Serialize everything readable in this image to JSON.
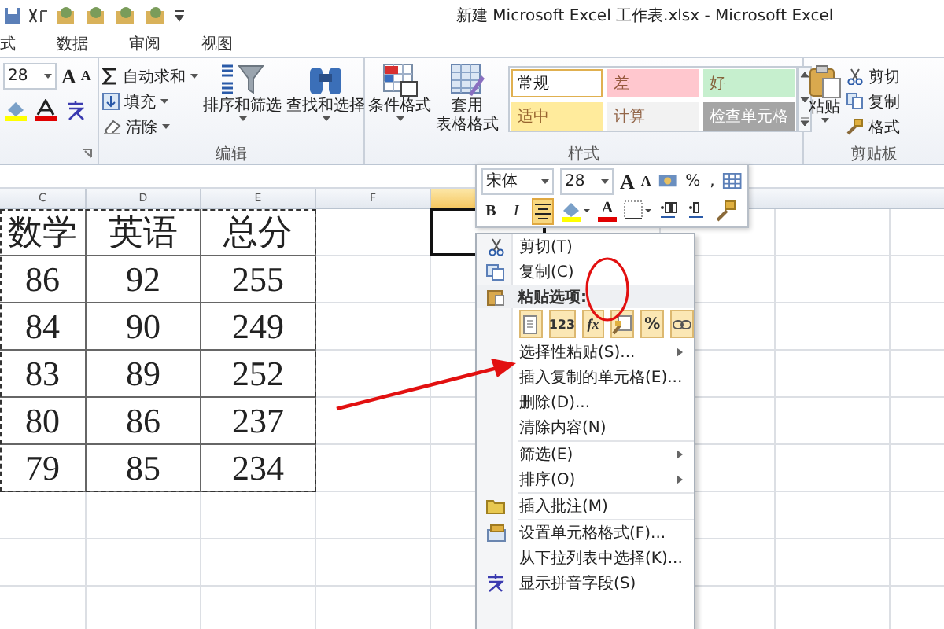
{
  "title_bar": {
    "title": "新建 Microsoft Excel 工作表.xlsx - Microsoft Excel"
  },
  "tabs": [
    {
      "label": "式",
      "selected": false
    },
    {
      "label": "数据",
      "selected": false
    },
    {
      "label": "审阅",
      "selected": false
    },
    {
      "label": "视图",
      "selected": false
    }
  ],
  "ribbon": {
    "font_group": {
      "font_size": "28",
      "grow": "A",
      "shrink": "A"
    },
    "editing_group": {
      "label": "编辑",
      "small_buttons": [
        "自动求和",
        "填充",
        "清除"
      ],
      "large_buttons": [
        {
          "lines": [
            "排序和筛选"
          ]
        },
        {
          "lines": [
            "查找和选择"
          ]
        }
      ]
    },
    "styles_group": {
      "label": "样式",
      "large_buttons": [
        {
          "lines": [
            "条件格式"
          ]
        },
        {
          "lines": [
            "套用",
            "表格格式"
          ]
        }
      ],
      "cell_styles": [
        {
          "label": "常规",
          "color": "#ffffff",
          "selected": true
        },
        {
          "label": "差",
          "color": "#ffc7ce",
          "selected": false
        },
        {
          "label": "好",
          "color": "#c6efce",
          "selected": false
        },
        {
          "label": "适中",
          "color": "#ffeb9c",
          "selected": false
        },
        {
          "label": "计算",
          "color": "#f2f2f2",
          "selected": false
        },
        {
          "label": "检查单元格",
          "color": "#a5a5a5",
          "selected": false
        }
      ]
    },
    "clipboard_group": {
      "label": "剪贴板",
      "paste": "粘贴",
      "small_buttons": [
        "剪切",
        "复制",
        "格式"
      ]
    }
  },
  "sheet": {
    "columns": [
      {
        "label": "C",
        "selected": false
      },
      {
        "label": "D",
        "selected": false
      },
      {
        "label": "E",
        "selected": false
      },
      {
        "label": "F",
        "selected": false
      },
      {
        "selected": true
      }
    ],
    "rows": [
      [
        "数学",
        "英语",
        "总分"
      ],
      [
        "86",
        "92",
        "255"
      ],
      [
        "84",
        "90",
        "249"
      ],
      [
        "83",
        "89",
        "252"
      ],
      [
        "80",
        "86",
        "237"
      ],
      [
        "79",
        "85",
        "234"
      ]
    ],
    "copy_marquee": true
  },
  "mini_toolbar": {
    "font": "宋体",
    "size": "28",
    "grow": "A",
    "shrink": "A",
    "percent": "%",
    "comma": ",",
    "buttons": [
      {
        "kind": "bold",
        "label": "B",
        "selected": false
      },
      {
        "kind": "italic",
        "label": "I",
        "selected": false
      },
      {
        "kind": "center",
        "selected": true
      },
      {
        "kind": "fill"
      },
      {
        "kind": "font-color",
        "label": "A"
      },
      {
        "kind": "border"
      },
      {
        "kind": "inc-decimal"
      },
      {
        "kind": "dec-decimal"
      },
      {
        "kind": "painter"
      }
    ]
  },
  "context_menu": {
    "items": [
      {
        "kind": "cut",
        "label": "剪切(T)"
      },
      {
        "kind": "copy",
        "label": "复制(C)"
      },
      {
        "kind": "paste-header",
        "label": "粘贴选项:"
      },
      {
        "kind": "paste-options",
        "options": [
          {
            "kind": "paste"
          },
          {
            "kind": "values",
            "text": "123"
          },
          {
            "kind": "formula",
            "text": "fx"
          },
          {
            "kind": "formatting"
          },
          {
            "kind": "percent",
            "text": "%"
          },
          {
            "kind": "link"
          }
        ]
      },
      {
        "kind": "submenu",
        "label": "选择性粘贴(S)..."
      },
      {
        "kind": "plain",
        "label": "插入复制的单元格(E)..."
      },
      {
        "kind": "plain",
        "label": "删除(D)..."
      },
      {
        "kind": "plain",
        "label": "清除内容(N)"
      },
      {
        "kind": "separator"
      },
      {
        "kind": "submenu",
        "label": "筛选(E)"
      },
      {
        "kind": "submenu",
        "label": "排序(O)"
      },
      {
        "kind": "separator"
      },
      {
        "kind": "comment",
        "label": "插入批注(M)"
      },
      {
        "kind": "separator"
      },
      {
        "kind": "format",
        "label": "设置单元格格式(F)..."
      },
      {
        "kind": "plain",
        "label": "从下拉列表中选择(K)..."
      },
      {
        "kind": "pinyin",
        "label": "显示拼音字段(S)"
      }
    ]
  }
}
